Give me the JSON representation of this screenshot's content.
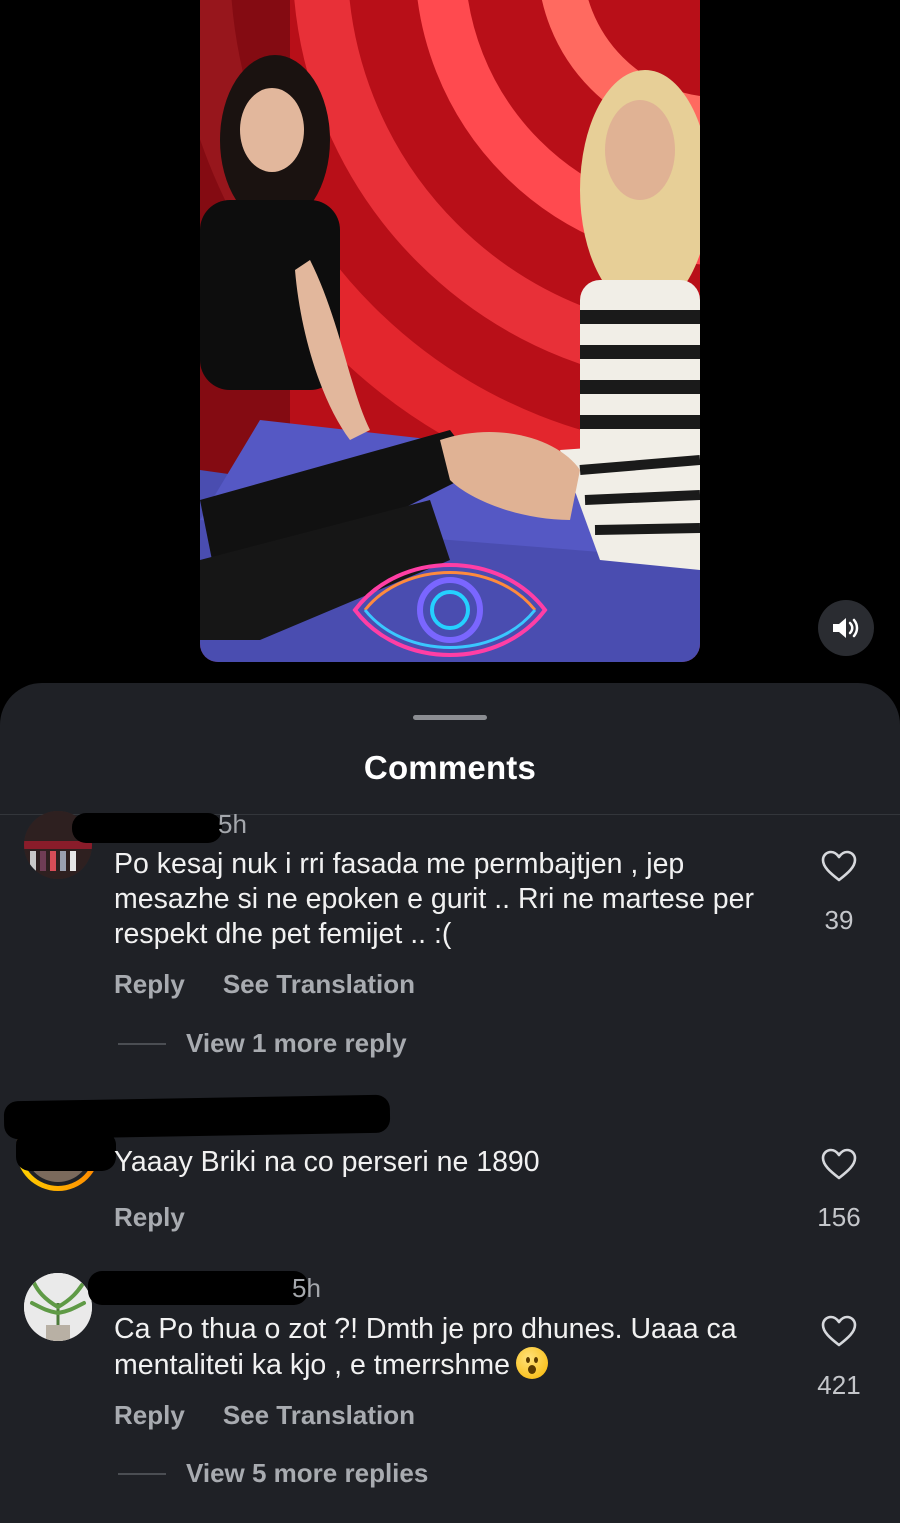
{
  "video": {
    "media_icon": "big-brother-eye-logo",
    "mute_icon": "speaker-icon"
  },
  "sheet": {
    "title": "Comments"
  },
  "comments": [
    {
      "time": "5h",
      "text": "Po kesaj nuk i rri fasada me permbajtjen , jep mesazhe si ne epoken e gurit .. Rri ne martese per respekt dhe pet femijet .. :(",
      "reply_label": "Reply",
      "translate_label": "See Translation",
      "likes": "39",
      "view_replies": "View 1 more reply"
    },
    {
      "time": "",
      "text": "Yaaay Briki na co perseri ne 1890",
      "reply_label": "Reply",
      "likes": "156"
    },
    {
      "time": "5h",
      "text": "Ca Po thua o zot ?! Dmth je pro dhunes. Uaaa ca mentaliteti ka kjo , e tmerrshme",
      "reply_label": "Reply",
      "translate_label": "See Translation",
      "likes": "421",
      "view_replies": "View 5 more replies"
    }
  ],
  "colors": {
    "background": "#000000",
    "sheet": "#1f2126",
    "secondary_text": "#a8abb0"
  }
}
